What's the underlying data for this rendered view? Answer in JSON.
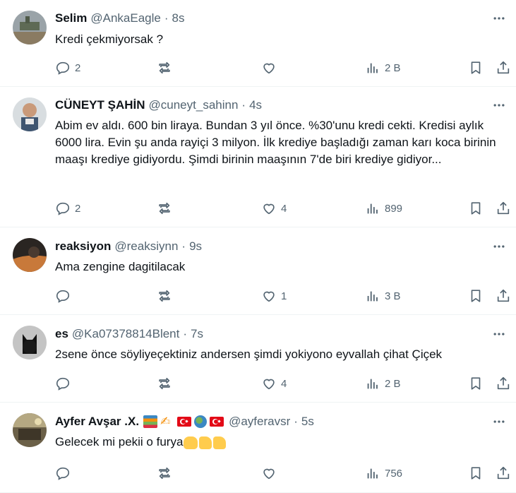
{
  "tweets": [
    {
      "name": "Selim",
      "handle": "@AnkaEagle",
      "dot": "·",
      "time": "8s",
      "text": "Kredi çekmiyorsak ?",
      "replies": "2",
      "retweets": "",
      "likes": "",
      "views": "2 B"
    },
    {
      "name": "CÜNEYT ŞAHİN",
      "handle": "@cuneyt_sahinn",
      "dot": "·",
      "time": "4s",
      "text": "Abim ev aldı. 600 bin liraya. Bundan 3 yıl önce. %30'unu kredi cekti. Kredisi aylık 6000 lira. Evin şu anda rayiçi 3 milyon. İlk krediye başladığı zaman karı koca birinin maaşı krediye gidiyordu. Şimdi birinin maaşının 7'de biri krediye gidiyor...",
      "replies": "2",
      "retweets": "",
      "likes": "4",
      "views": "899"
    },
    {
      "name": "reaksiyon",
      "handle": "@reaksiynn",
      "dot": "·",
      "time": "9s",
      "text": "Ama zengine dagitilacak",
      "replies": "",
      "retweets": "",
      "likes": "1",
      "views": "3 B"
    },
    {
      "name": "es",
      "handle": "@Ka07378814Blent",
      "dot": "·",
      "time": "7s",
      "text": "2sene önce söyliyeçektiniz andersen şimdi yokiyono eyvallah çihat Çiçek",
      "replies": "",
      "retweets": "",
      "likes": "4",
      "views": "2 B"
    },
    {
      "name": "Ayfer Avşar .X.",
      "handle": "@ayferavsr",
      "dot": "·",
      "time": "5s",
      "text": "Gelecek  mi pekii o furya",
      "replies": "",
      "retweets": "",
      "likes": "",
      "views": "756"
    }
  ],
  "icons": {
    "reply": "reply-icon",
    "retweet": "retweet-icon",
    "like": "heart-icon",
    "views": "views-icon",
    "bookmark": "bookmark-icon",
    "share": "share-icon",
    "more": "more-icon"
  },
  "colors": {
    "text": "#0f1419",
    "secondary": "#536471",
    "divider": "#eff3f4"
  }
}
